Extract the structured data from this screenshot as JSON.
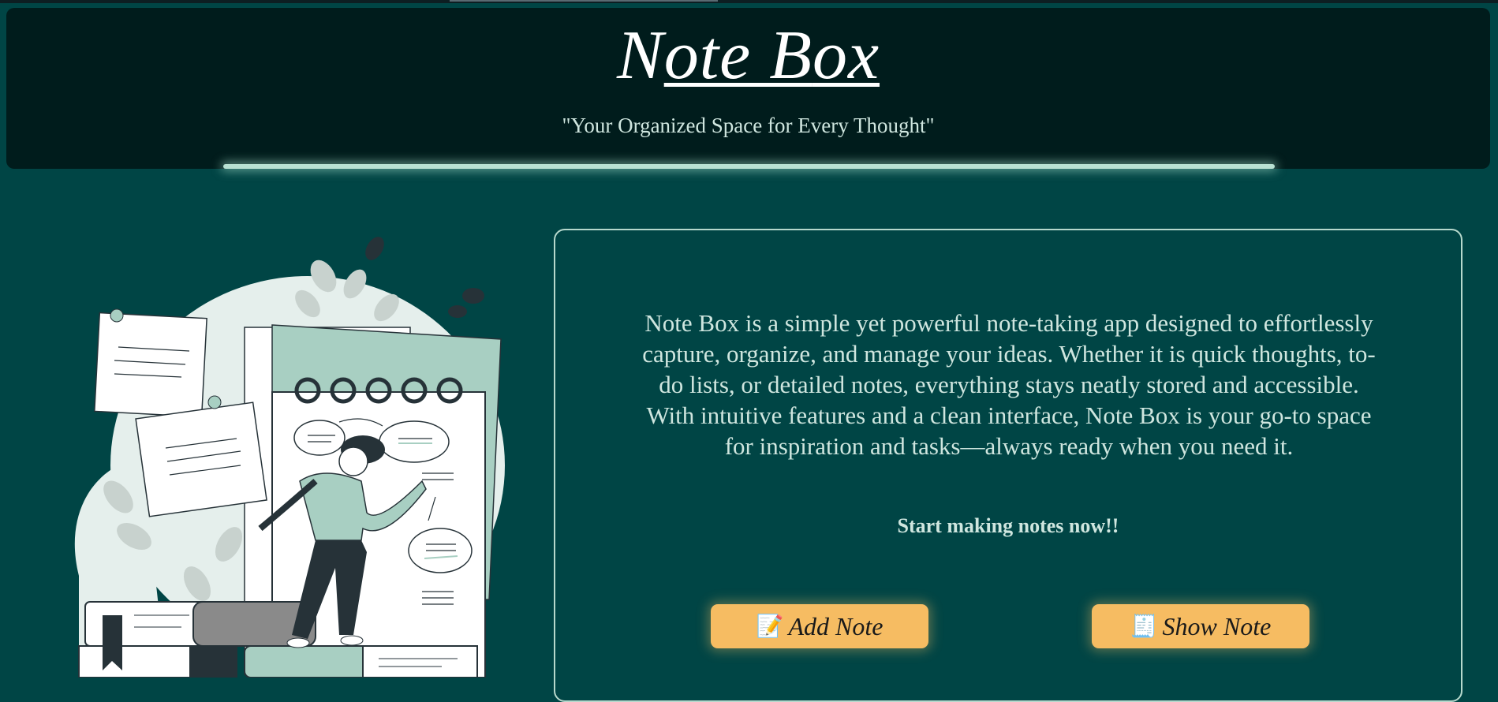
{
  "header": {
    "title_part1": "N",
    "title_part2": "ote B",
    "title_part3": "ox",
    "tagline": "\"Your Organized Space for Every Thought\""
  },
  "main": {
    "description": "Note Box is a simple yet powerful note-taking app designed to effortlessly capture, organize, and manage your ideas. Whether it is quick thoughts, to-do lists, or detailed notes, everything stays neatly stored and accessible. With intuitive features and a clean interface, Note Box is your go-to space for inspiration and tasks—always ready when you need it.",
    "cta": "Start making notes now!!",
    "buttons": {
      "add": {
        "icon": "📝",
        "label": "Add Note"
      },
      "show": {
        "icon": "🧾",
        "label": "Show Note"
      }
    }
  },
  "colors": {
    "background": "#004545",
    "header": "#001c1c",
    "button": "#f6bc62",
    "text": "#cfe6df",
    "accent": "#b9e0d2"
  },
  "icons": [
    "memo-icon",
    "receipt-icon"
  ]
}
